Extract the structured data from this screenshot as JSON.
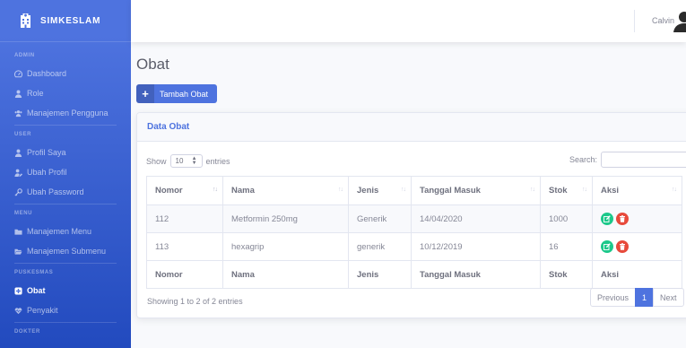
{
  "brand": {
    "name": "SIMKESLAM",
    "icon": "hospital-icon"
  },
  "sidebar": {
    "sections": [
      {
        "heading": "ADMIN",
        "items": [
          {
            "label": "Dashboard",
            "icon": "dashboard-icon"
          },
          {
            "label": "Role",
            "icon": "user-tie-icon"
          },
          {
            "label": "Manajemen Pengguna",
            "icon": "users-icon"
          }
        ]
      },
      {
        "heading": "USER",
        "items": [
          {
            "label": "Profil Saya",
            "icon": "user-icon"
          },
          {
            "label": "Ubah Profil",
            "icon": "user-edit-icon"
          },
          {
            "label": "Ubah Password",
            "icon": "key-icon"
          }
        ]
      },
      {
        "heading": "MENU",
        "items": [
          {
            "label": "Manajemen Menu",
            "icon": "folder-icon"
          },
          {
            "label": "Manajemen Submenu",
            "icon": "folder-open-icon"
          }
        ]
      },
      {
        "heading": "PUSKESMAS",
        "items": [
          {
            "label": "Obat",
            "icon": "pills-icon",
            "active": true
          },
          {
            "label": "Penyakit",
            "icon": "heartbeat-icon"
          }
        ]
      },
      {
        "heading": "DOKTER",
        "items": []
      }
    ]
  },
  "topbar": {
    "username": "Calvin",
    "avatar_icon": "user-avatar-icon"
  },
  "page": {
    "title": "Obat",
    "add_button_label": "Tambah Obat"
  },
  "card": {
    "title": "Data Obat",
    "show_label": "Show",
    "entries_label": "entries",
    "page_length": "10",
    "search_label": "Search:",
    "search_value": "",
    "columns": [
      "Nomor",
      "Nama",
      "Jenis",
      "Tanggal Masuk",
      "Stok",
      "Aksi"
    ],
    "rows": [
      {
        "nomor": "112",
        "nama": "Metformin 250mg",
        "jenis": "Generik",
        "tanggal_masuk": "14/04/2020",
        "stok": "1000"
      },
      {
        "nomor": "113",
        "nama": "hexagrip",
        "jenis": "generik",
        "tanggal_masuk": "10/12/2019",
        "stok": "16"
      }
    ],
    "info": "Showing 1 to 2 of 2 entries",
    "pagination": {
      "previous": "Previous",
      "current": "1",
      "next": "Next"
    }
  },
  "colors": {
    "primary": "#4e73df",
    "success": "#1cc88a",
    "danger": "#e74a3b"
  }
}
